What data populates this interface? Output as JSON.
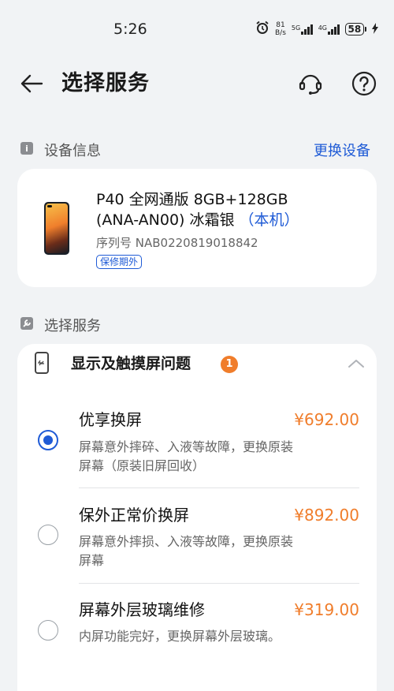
{
  "status_bar": {
    "time": "5:26",
    "net_speed_value": "81",
    "net_speed_unit": "B/s",
    "signal1_label": "5G",
    "signal2_label": "4G",
    "battery": "58"
  },
  "header": {
    "title": "选择服务"
  },
  "device_section": {
    "label": "设备信息",
    "change_link": "更换设备",
    "line1": "P40 全网通版 8GB+128GB",
    "line2": "(ANA-AN00) 冰霜银",
    "this_device": "（本机）",
    "serial": "序列号 NAB0220819018842",
    "warranty_badge": "保修期外"
  },
  "service_section": {
    "label": "选择服务",
    "category_title": "显示及触摸屏问题",
    "category_count": "1",
    "options": [
      {
        "name": "优享换屏",
        "price": "¥692.00",
        "desc": "屏幕意外摔碎、入液等故障，更换原装屏幕（原装旧屏回收）",
        "selected": true
      },
      {
        "name": "保外正常价换屏",
        "price": "¥892.00",
        "desc": "屏幕意外摔损、入液等故障，更换原装屏幕",
        "selected": false
      },
      {
        "name": "屏幕外层玻璃维修",
        "price": "¥319.00",
        "desc": "内屏功能完好，更换屏幕外层玻璃。",
        "selected": false
      }
    ]
  },
  "colors": {
    "accent": "#1f5bd6",
    "price": "#f07d2b",
    "background": "#f1f3f5"
  }
}
